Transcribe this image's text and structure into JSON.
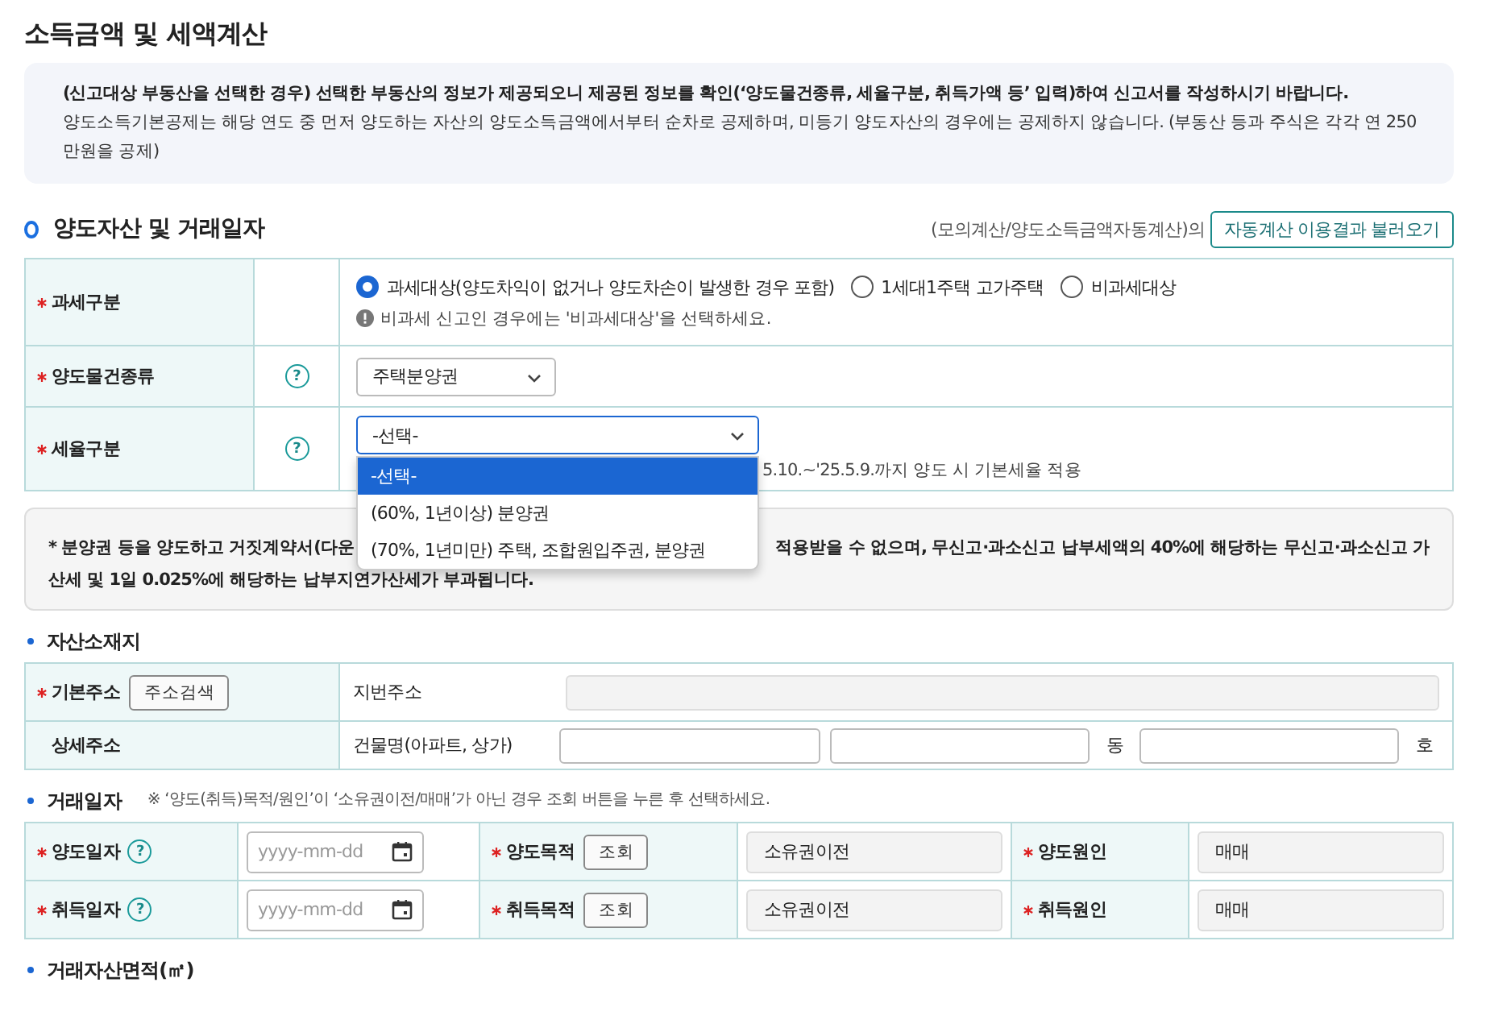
{
  "title": "소득금액 및 세액계산",
  "notices": [
    "(신고대상 부동산을 선택한 경우) 선택한 부동산의 정보가 제공되오니 제공된 정보를 확인(‘양도물건종류, 세율구분, 취득가액 등’ 입력)하여 신고서를 작성하시기 바랍니다.",
    "양도소득기본공제는 해당 연도 중 먼저 양도하는 자산의 양도소득금액에서부터 순차로 공제하며, 미등기 양도자산의 경우에는 공제하지 않습니다. (부동산 등과 주식은 각각 연 250만원을 공제)"
  ],
  "section": {
    "title": "양도자산 및 거래일자",
    "note": "(모의계산/양도소득금액자동계산)의",
    "button": "자동계산 이용결과 불러오기"
  },
  "asset_rows": [
    {
      "kind": "radio",
      "label": "과세구분",
      "required": true,
      "options": [
        {
          "label": "과세대상(양도차익이 없거나 양도차손이 발생한 경우 포함)",
          "selected": true
        },
        {
          "label": "1세대1주택 고가주택",
          "selected": false
        },
        {
          "label": "비과세대상",
          "selected": false
        }
      ],
      "hint": "비과세 신고인 경우에는 '비과세대상'을 선택하세요."
    },
    {
      "kind": "select",
      "label": "양도물건종류",
      "required": true,
      "help": "?",
      "value": "주택분양권"
    },
    {
      "kind": "select_open",
      "label": "세율구분",
      "required": true,
      "help": "?",
      "value": "-선택-",
      "hint": "5.10.~'25.5.9.까지 양도 시 기본세율 적용",
      "options": [
        {
          "label": "-선택-",
          "selected": true
        },
        {
          "label": "(60%, 1년이상) 분양권",
          "selected": false
        },
        {
          "label": "(70%, 1년미만) 주택, 조합원입주권, 분양권",
          "selected": false
        }
      ]
    }
  ],
  "warning": {
    "line_1_start": "* 분양권 등을 양도하고 거짓계약서(다운",
    "line_1_end": "적용받을 수 없으며, 무신고·과소신고 납부세액의 40%에 해당하는 무신고·과소신고 가",
    "line_2": "산세 및 1일 0.025%에 해당하는 납부지연가산세가 부과됩니다."
  },
  "address": {
    "title": "자산소재지",
    "basic": {
      "label": "기본주소",
      "required": true,
      "button": "주소검색",
      "field_label": "지번주소"
    },
    "detail": {
      "label": "상세주소",
      "required": false,
      "field_label": "건물명(아파트, 상가)",
      "units": [
        "동",
        "호"
      ]
    }
  },
  "deal": {
    "title": "거래일자",
    "note": "※ ‘양도(취득)목적/원인’이 ‘소유권이전/매매’가 아닌 경우 조회 버튼을 누른 후 선택하세요.",
    "rows": [
      {
        "date_label": "양도일자",
        "help": "?",
        "placeholder": "yyyy-mm-dd",
        "purpose_label": "양도목적",
        "button": "조회",
        "purpose": "소유권이전",
        "cause_label": "양도원인",
        "cause": "매매"
      },
      {
        "date_label": "취득일자",
        "help": "?",
        "placeholder": "yyyy-mm-dd",
        "purpose_label": "취득목적",
        "button": "조회",
        "purpose": "소유권이전",
        "cause_label": "취득원인",
        "cause": "매매"
      }
    ]
  },
  "area_title": "거래자산면적(㎡)"
}
